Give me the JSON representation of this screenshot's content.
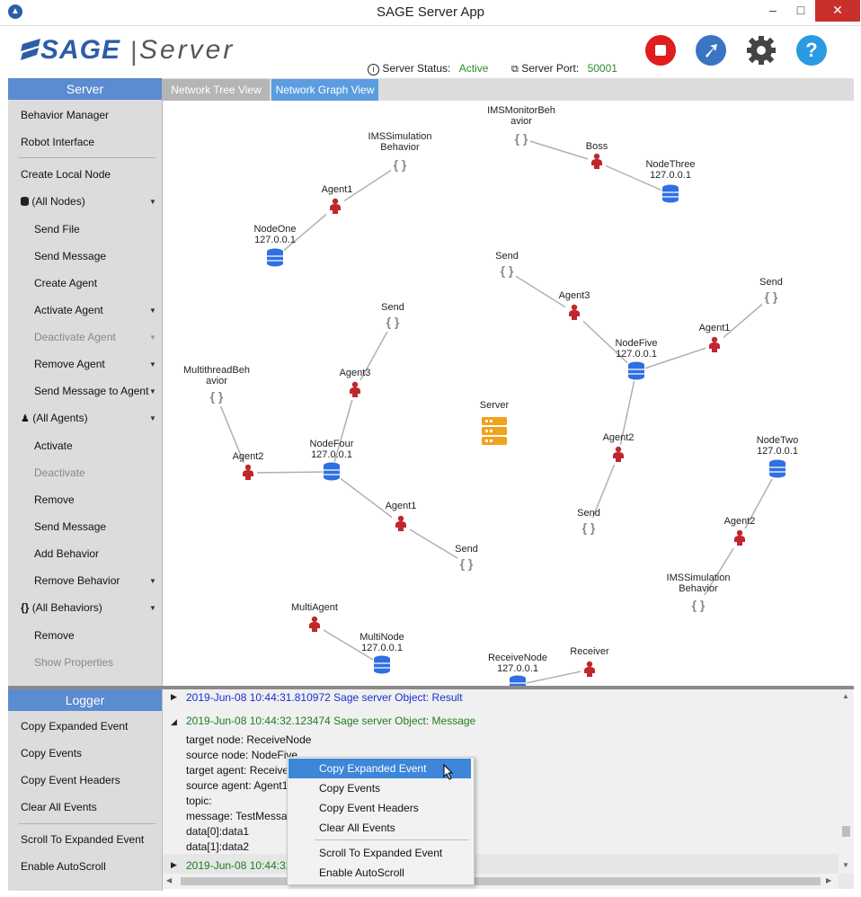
{
  "window": {
    "title": "SAGE Server App",
    "minimize": "‒",
    "maximize": "□",
    "close": "✕"
  },
  "header": {
    "logo_sage": "SAGE",
    "logo_bar": "|",
    "logo_server": "Server",
    "status_label": "Server Status:",
    "status_value": "Active",
    "port_label": "Server Port:",
    "port_value": "50001",
    "buttons": [
      "stop-icon",
      "share-icon",
      "gear-icon",
      "help-icon"
    ],
    "colors": {
      "stop": "#e01c1c",
      "share": "#3a74c4",
      "gear": "#444444",
      "help": "#2a9be0"
    }
  },
  "sidebar": {
    "heading": "Server",
    "items": [
      {
        "label": "Behavior Manager"
      },
      {
        "label": "Robot Interface"
      },
      {
        "label": "Create Local Node"
      },
      {
        "label": "(All Nodes)"
      },
      {
        "label": "Send File"
      },
      {
        "label": "Send Message"
      },
      {
        "label": "Create Agent"
      },
      {
        "label": "Activate Agent"
      },
      {
        "label": "Deactivate Agent"
      },
      {
        "label": "Remove Agent"
      },
      {
        "label": "Send Message to Agent"
      },
      {
        "label": "(All Agents)"
      },
      {
        "label": "Activate"
      },
      {
        "label": "Deactivate"
      },
      {
        "label": "Remove"
      },
      {
        "label": "Send Message"
      },
      {
        "label": "Add Behavior"
      },
      {
        "label": "Remove Behavior"
      },
      {
        "label": "(All Behaviors)"
      },
      {
        "label": "Remove"
      },
      {
        "label": "Show Properties"
      }
    ],
    "behaviors_glyph": "{}"
  },
  "tabs": [
    {
      "label": "Network Tree View"
    },
    {
      "label": "Network Graph View"
    }
  ],
  "graph": {
    "labels": {
      "ims_monitor": [
        "IMSMonitorBeh",
        "avior"
      ],
      "boss": [
        "Boss"
      ],
      "node_three": [
        "NodeThree",
        "127.0.0.1"
      ],
      "ims_sim_1": [
        "IMSSimulation",
        "Behavior"
      ],
      "agent1_a": [
        "Agent1"
      ],
      "node_one": [
        "NodeOne",
        "127.0.0.1"
      ],
      "send_a": [
        "Send"
      ],
      "agent3_a": [
        "Agent3"
      ],
      "send_b": [
        "Send"
      ],
      "agent1_b": [
        "Agent1"
      ],
      "node_five": [
        "NodeFive",
        "127.0.0.1"
      ],
      "send_c": [
        "Send"
      ],
      "agent3_b": [
        "Agent3"
      ],
      "multithread": [
        "MultithreadBeh",
        "avior"
      ],
      "server": [
        "Server"
      ],
      "agent2_a": [
        "Agent2"
      ],
      "node_four": [
        "NodeFour",
        "127.0.0.1"
      ],
      "agent2_b": [
        "Agent2"
      ],
      "node_two": [
        "NodeTwo",
        "127.0.0.1"
      ],
      "agent1_c": [
        "Agent1"
      ],
      "send_d": [
        "Send"
      ],
      "send_e": [
        "Send"
      ],
      "agent2_c": [
        "Agent2"
      ],
      "ims_sim_2": [
        "IMSSimulation",
        "Behavior"
      ],
      "multi_agent": [
        "MultiAgent"
      ],
      "multi_node": [
        "MultiNode",
        "127.0.0.1"
      ],
      "receive_node": [
        "ReceiveNode",
        "127.0.0.1"
      ],
      "receiver": [
        "Receiver"
      ]
    },
    "colors": {
      "agent": "#c0272d",
      "node": "#2f6fe4",
      "behavior": "#888888",
      "server": "#f3a21c",
      "edge": "#b0b0b0"
    }
  },
  "logger": {
    "heading": "Logger",
    "items": [
      {
        "label": "Copy Expanded Event"
      },
      {
        "label": "Copy Events"
      },
      {
        "label": "Copy Event Headers"
      },
      {
        "label": "Clear All Events"
      },
      {
        "label": "Scroll To Expanded Event"
      },
      {
        "label": "Enable AutoScroll"
      }
    ],
    "events": [
      {
        "text": "2019-Jun-08 10:44:31.810972 Sage server Object: Result",
        "color": "#1a2fd0",
        "expanded": false
      },
      {
        "text": "2019-Jun-08 10:44:32.123474 Sage server Object: Message",
        "color": "#1e7d1e",
        "expanded": true
      },
      {
        "text": "2019-Jun-08 10:44:32.",
        "color": "#1e7d1e",
        "expanded": false
      }
    ],
    "details": [
      "target node: ReceiveNode",
      "source node: NodeFive",
      "target agent: Receiver",
      "source agent: Agent1",
      "topic:",
      "message: TestMessag",
      "data[0]:data1",
      "data[1]:data2"
    ]
  },
  "context_menu": {
    "items": [
      {
        "label": "Copy Expanded Event"
      },
      {
        "label": "Copy Events"
      },
      {
        "label": "Copy Event Headers"
      },
      {
        "label": "Clear All Events"
      },
      {
        "label": "Scroll To Expanded Event"
      },
      {
        "label": "Enable AutoScroll"
      }
    ]
  }
}
